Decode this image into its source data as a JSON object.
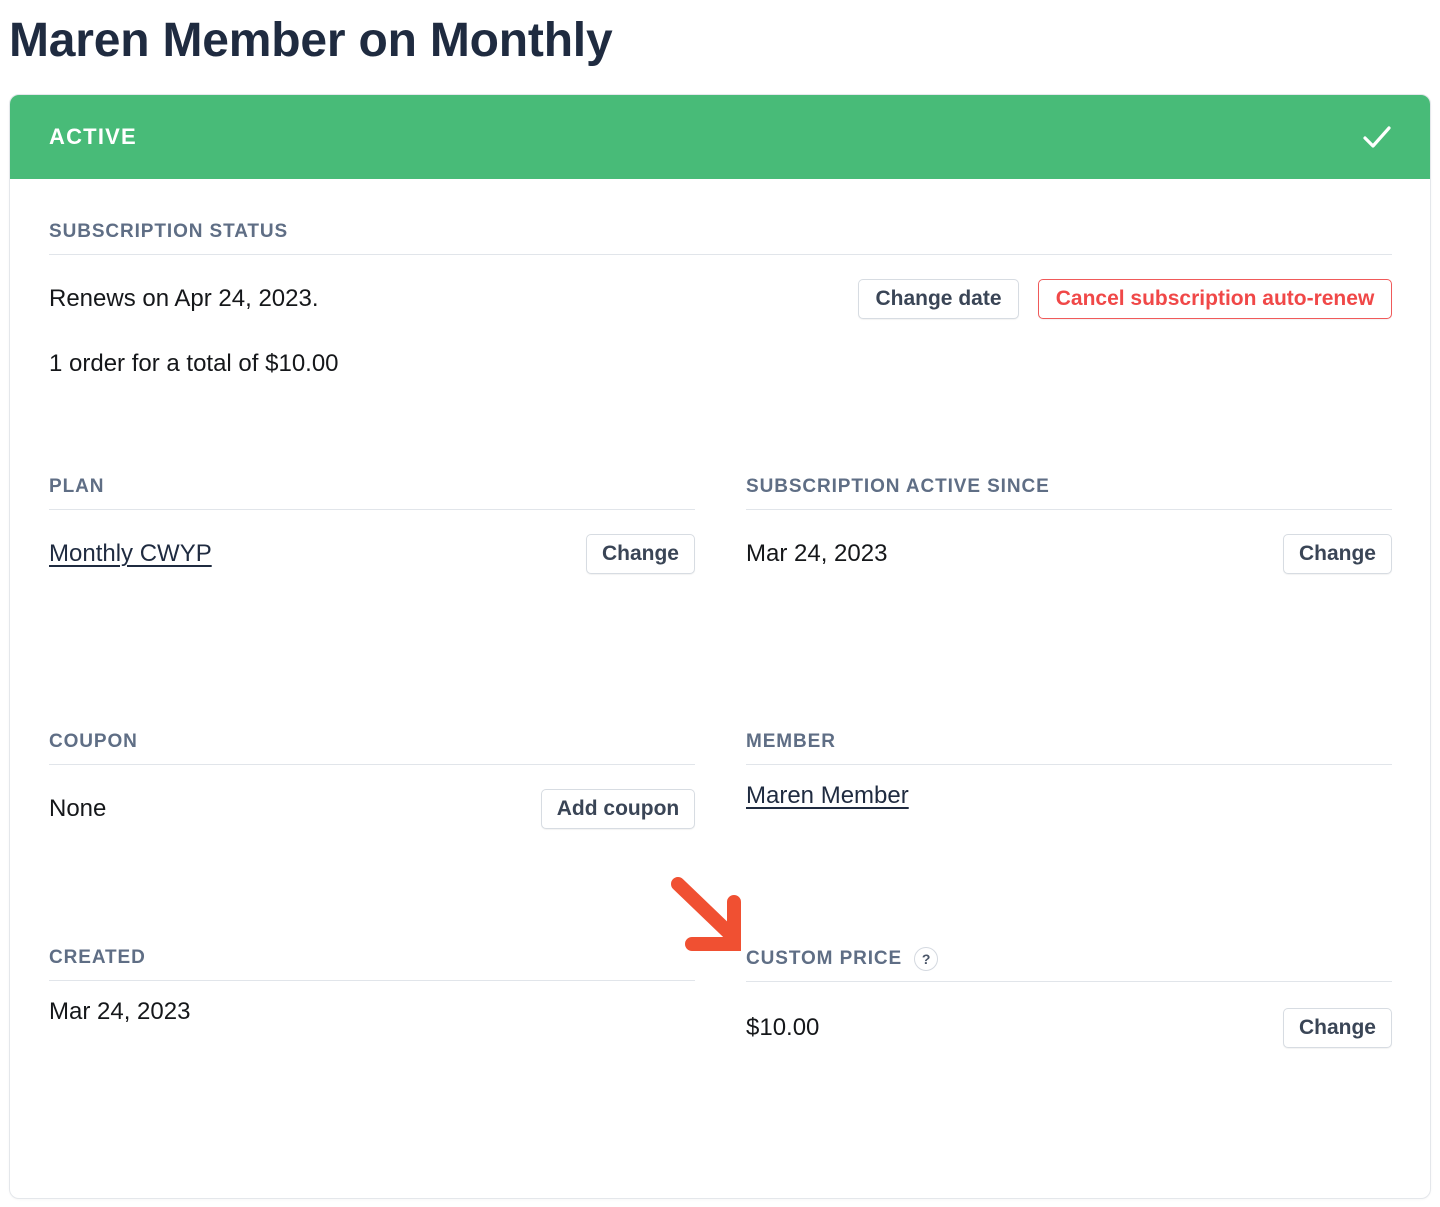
{
  "page_title": "Maren Member on Monthly",
  "status": {
    "label": "ACTIVE",
    "icon": "check-icon",
    "color": "#48bb78"
  },
  "subscription_status": {
    "heading": "SUBSCRIPTION STATUS",
    "renews_text": "Renews on Apr 24, 2023.",
    "orders_text": "1 order for a total of $10.00",
    "change_date_label": "Change date",
    "cancel_label": "Cancel subscription auto-renew",
    "cancel_color": "#f04848"
  },
  "plan": {
    "heading": "PLAN",
    "value": "Monthly CWYP",
    "button_label": "Change"
  },
  "active_since": {
    "heading": "SUBSCRIPTION ACTIVE SINCE",
    "value": "Mar 24, 2023",
    "button_label": "Change"
  },
  "coupon": {
    "heading": "COUPON",
    "value": "None",
    "button_label": "Add coupon"
  },
  "member": {
    "heading": "MEMBER",
    "value": "Maren Member"
  },
  "created": {
    "heading": "CREATED",
    "value": "Mar 24, 2023"
  },
  "custom_price": {
    "heading": "CUSTOM PRICE",
    "help": "?",
    "value": "$10.00",
    "button_label": "Change"
  },
  "annotation": {
    "icon": "arrow-icon",
    "color": "#f05032"
  }
}
